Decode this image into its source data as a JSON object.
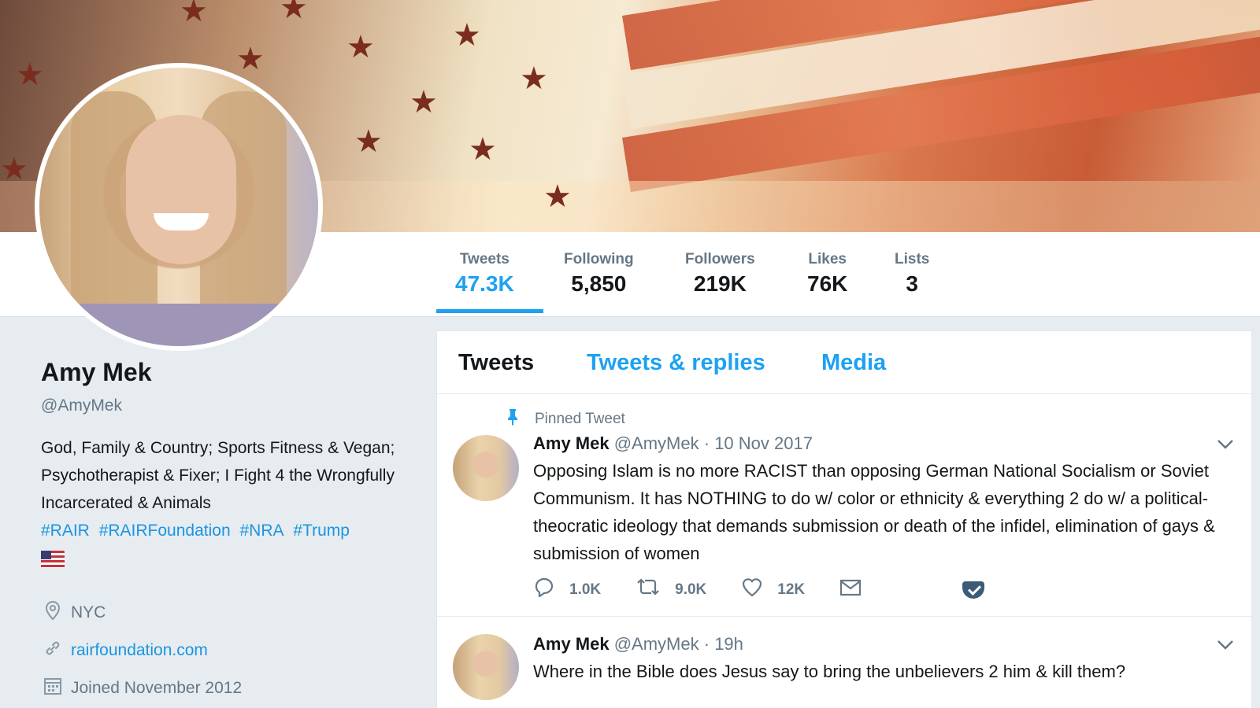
{
  "profile": {
    "name": "Amy Mek",
    "handle": "@AmyMek",
    "bio": "God, Family & Country; Sports Fitness & Vegan; Psychotherapist & Fixer; I Fight 4 the Wrongfully Incarcerated & Animals",
    "hashtags": [
      "#RAIR",
      "#RAIRFoundation",
      "#NRA",
      "#Trump"
    ],
    "flag_icon": "us-flag-emoji",
    "location": "NYC",
    "website": "rairfoundation.com",
    "joined": "Joined November 2012"
  },
  "stats": [
    {
      "label": "Tweets",
      "value": "47.3K",
      "active": true
    },
    {
      "label": "Following",
      "value": "5,850"
    },
    {
      "label": "Followers",
      "value": "219K"
    },
    {
      "label": "Likes",
      "value": "76K"
    },
    {
      "label": "Lists",
      "value": "3"
    }
  ],
  "tabs": [
    "Tweets",
    "Tweets & replies",
    "Media"
  ],
  "tweets": [
    {
      "pinned_label": "Pinned Tweet",
      "name": "Amy Mek",
      "handle": "@AmyMek",
      "time": "· 10 Nov 2017",
      "text": "Opposing Islam is no more RACIST than opposing German National Socialism or Soviet Communism. It has NOTHING to do w/ color or ethnicity & everything 2 do w/ a political-theocratic ideology that demands submission or death of the infidel, elimination of gays & submission of women",
      "replies": "1.0K",
      "retweets": "9.0K",
      "likes": "12K"
    },
    {
      "name": "Amy Mek",
      "handle": "@AmyMek",
      "time": "· 19h",
      "text": "Where in the Bible does Jesus say to bring the unbelievers 2 him & kill them?"
    }
  ],
  "icons": {
    "location": "location-pin-icon",
    "link": "link-icon",
    "calendar": "calendar-icon",
    "pin": "pin-icon",
    "reply": "reply-icon",
    "retweet": "retweet-icon",
    "like": "heart-icon",
    "dm": "envelope-icon",
    "pocket": "pocket-icon",
    "chevron": "chevron-down-icon"
  },
  "colors": {
    "accent": "#1da1f2",
    "link": "#1b95e0",
    "text": "#14171a",
    "muted": "#657786",
    "background": "#e6ecf0"
  }
}
